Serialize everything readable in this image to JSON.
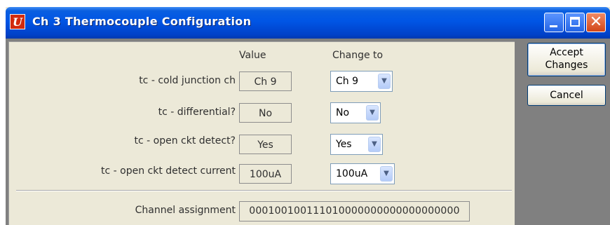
{
  "window": {
    "title": "Ch 3 Thermocouple Configuration",
    "app_icon_letter": "U"
  },
  "title_bar_buttons": {
    "close_glyph": "✕"
  },
  "headers": {
    "value": "Value",
    "change_to": "Change to"
  },
  "rows": [
    {
      "label": "tc - cold junction ch",
      "value": "Ch 9",
      "selected": "Ch 9"
    },
    {
      "label": "tc - differential?",
      "value": "No",
      "selected": "No"
    },
    {
      "label": "tc - open ckt detect?",
      "value": "Yes",
      "selected": "Yes"
    },
    {
      "label": "tc - open ckt detect current",
      "value": "100uA",
      "selected": "100uA"
    }
  ],
  "dropdown_arrow": "▼",
  "channel_assignment": {
    "label": "Channel assignment",
    "value": "000100100111010000000000000000000"
  },
  "buttons": {
    "accept_line1": "Accept",
    "accept_line2": "Changes",
    "cancel": "Cancel"
  },
  "colors": {
    "titlebar": "#0055e5",
    "close_button": "#d24517",
    "dialog_background": "#ece9d8",
    "client_gray": "#808080"
  }
}
